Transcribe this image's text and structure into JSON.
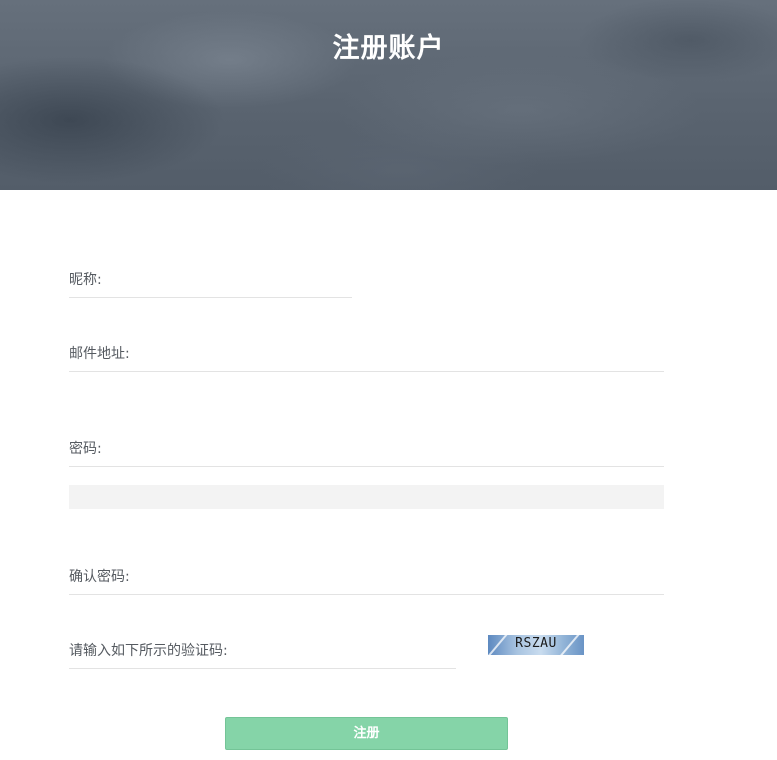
{
  "header": {
    "title": "注册账户"
  },
  "form": {
    "nickname_label": "昵称:",
    "email_label": "邮件地址:",
    "password_label": "密码:",
    "password_strength_level": 0,
    "confirm_password_label": "确认密码:",
    "captcha_label": "请输入如下所示的验证码:",
    "captcha_text": "RSZAU",
    "submit_label": "注册"
  },
  "colors": {
    "submit_button": "#85d4a8",
    "field_border": "#e3e3e3",
    "label_text": "#555a60",
    "captcha_background": "#8fb2d6"
  }
}
